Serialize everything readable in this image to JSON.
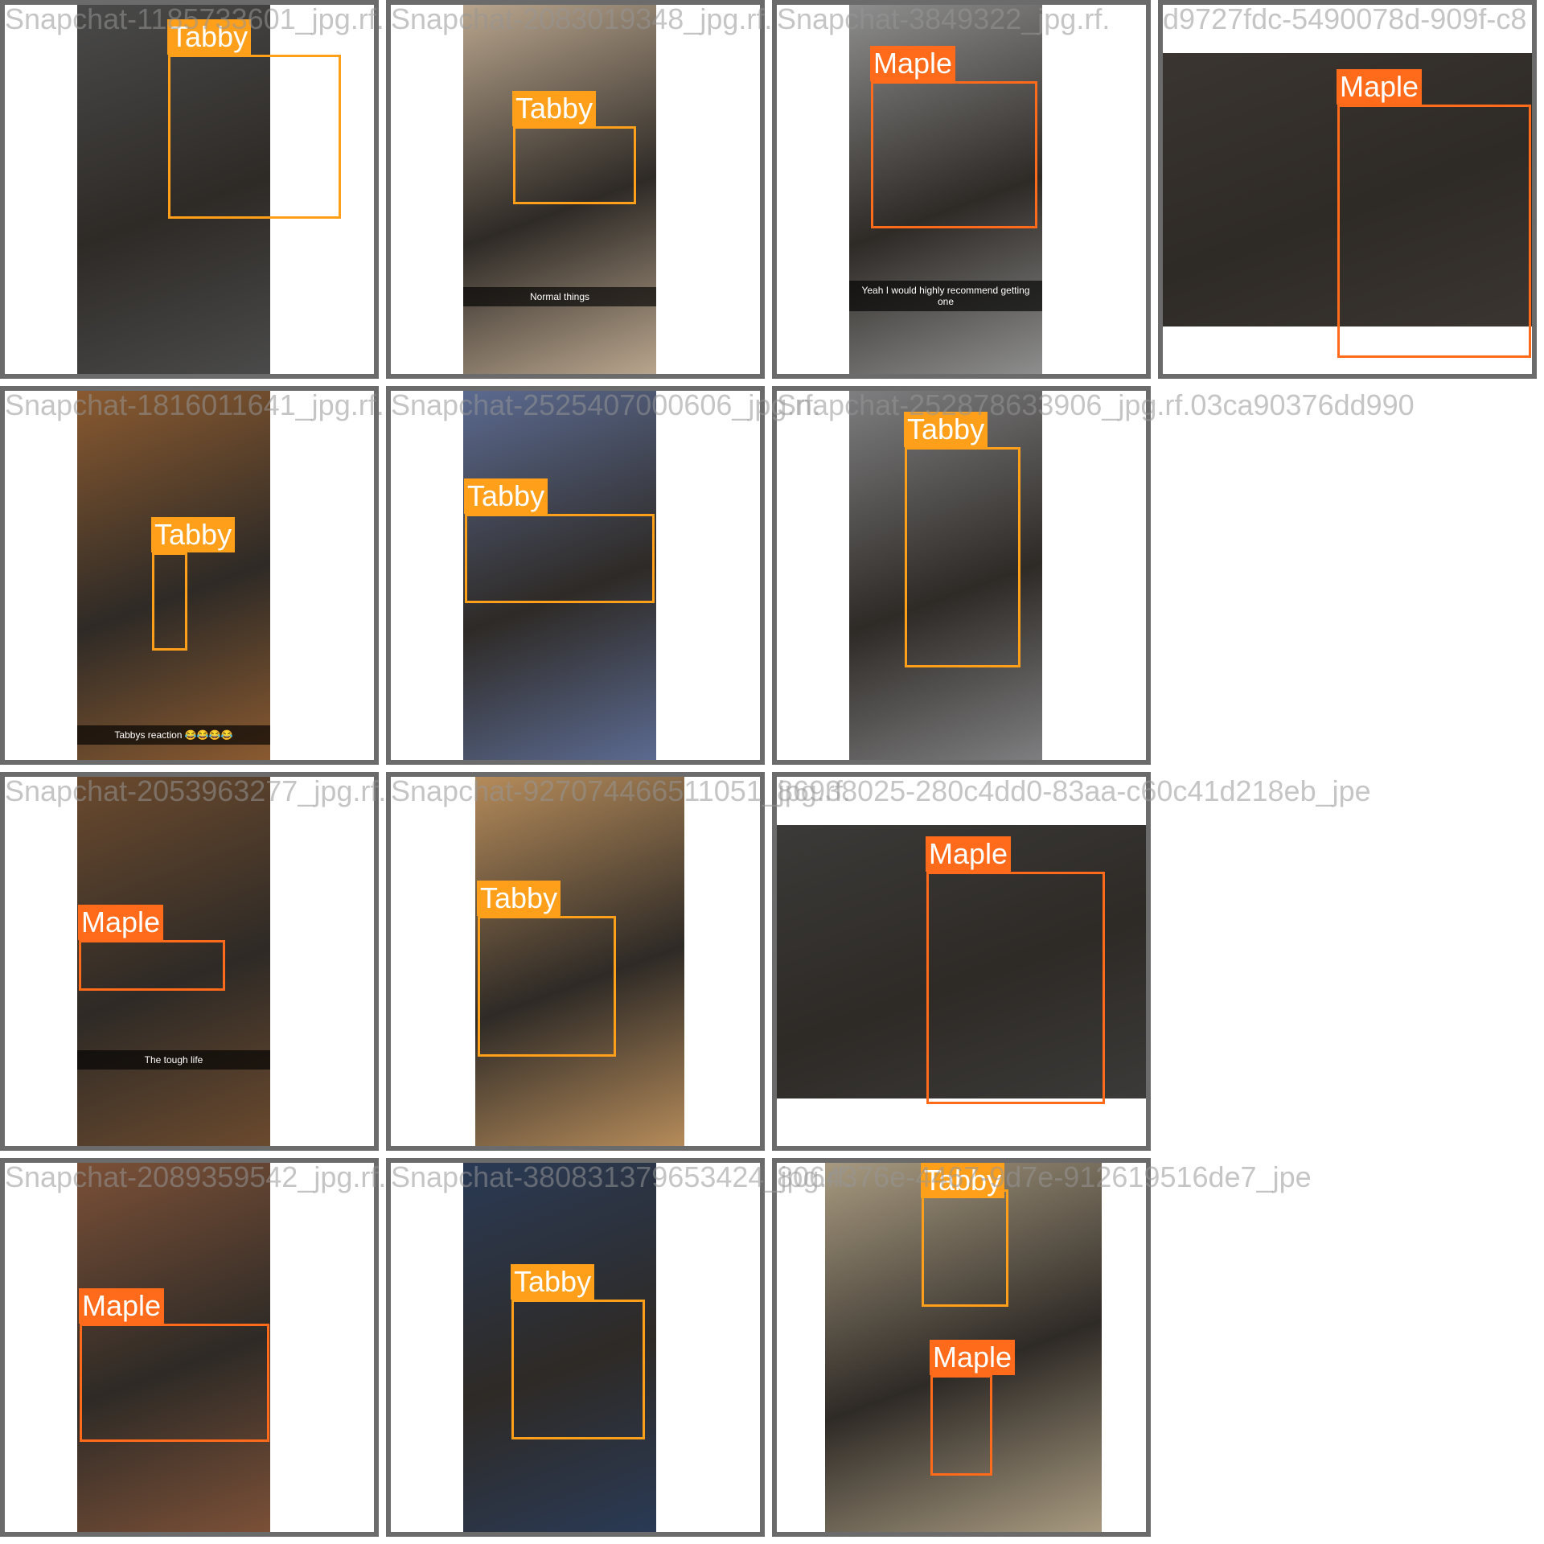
{
  "colors": {
    "tabby": "#ff9f1a",
    "maple": "#ff6b1a",
    "grid_border": "#6b6b6b",
    "filename_text": "#969696"
  },
  "tiles": [
    {
      "filename": "Snapchat-1185733601_jpg.rf.",
      "bg": "#4a4a4a",
      "photo": "portrait",
      "boxes": [
        {
          "label": "Tabby",
          "cls": "tabby"
        }
      ]
    },
    {
      "filename": "Snapchat-2083019348_jpg.rf.",
      "bg": "#b9a58d",
      "photo": "portrait",
      "boxes": [
        {
          "label": "Tabby",
          "cls": "tabby"
        }
      ],
      "caption": "Normal things"
    },
    {
      "filename": "Snapchat-3849322_jpg.rf.",
      "bg": "#8e8e8e",
      "photo": "portrait",
      "boxes": [
        {
          "label": "Maple",
          "cls": "maple"
        }
      ],
      "caption": "Yeah I would highly recommend getting one"
    },
    {
      "filename": "d9727fdc-5490078d-909f-c8",
      "bg": "#3a3530",
      "photo": "landscape",
      "boxes": [
        {
          "label": "Maple",
          "cls": "maple"
        }
      ]
    },
    {
      "filename": "Snapchat-1816011641_jpg.rf.",
      "bg": "#8a5a30",
      "photo": "portrait",
      "boxes": [
        {
          "label": "Tabby",
          "cls": "tabby"
        }
      ],
      "caption": "Tabbys  reaction 😂😂😂😂"
    },
    {
      "filename": "Snapchat-2525407000606_jpg.rf.",
      "bg": "#5b6a90",
      "photo": "portrait",
      "boxes": [
        {
          "label": "Tabby",
          "cls": "tabby"
        }
      ]
    },
    {
      "filename": "Snapchat-252878633906_jpg.rf.03ca90376dd990",
      "bg": "#7e7e80",
      "photo": "portrait",
      "boxes": [
        {
          "label": "Tabby",
          "cls": "tabby"
        }
      ]
    },
    {
      "filename": "",
      "empty": true
    },
    {
      "filename": "Snapchat-2053963277_jpg.rf.",
      "bg": "#6b4a2e",
      "photo": "portrait",
      "boxes": [
        {
          "label": "Maple",
          "cls": "maple"
        }
      ],
      "caption": "The tough life"
    },
    {
      "filename": "Snapchat-927074466511051_jpg.rf.",
      "bg": "#b58b5a",
      "photo": "portrait",
      "boxes": [
        {
          "label": "Tabby",
          "cls": "tabby"
        }
      ]
    },
    {
      "filename": "86938025-280c4dd0-83aa-c60c41d218eb_jpe",
      "bg": "#3b3a38",
      "photo": "landscape",
      "boxes": [
        {
          "label": "Maple",
          "cls": "maple"
        }
      ]
    },
    {
      "filename": "",
      "empty": true
    },
    {
      "filename": "Snapchat-2089359542_jpg.rf.",
      "bg": "#7b5037",
      "photo": "portrait",
      "boxes": [
        {
          "label": "Maple",
          "cls": "maple"
        }
      ]
    },
    {
      "filename": "Snapchat-380831379653424_jpg.rf.",
      "bg": "#2a3a55",
      "photo": "portrait",
      "boxes": [
        {
          "label": "Tabby",
          "cls": "tabby"
        }
      ]
    },
    {
      "filename": "8064376e-4467-9d7e-912619516de7_jpe",
      "bg": "#a89a80",
      "photo": "portrait",
      "boxes": [
        {
          "label": "Tabby",
          "cls": "tabby"
        },
        {
          "label": "Maple",
          "cls": "maple"
        }
      ]
    },
    {
      "filename": "",
      "empty": true
    }
  ]
}
